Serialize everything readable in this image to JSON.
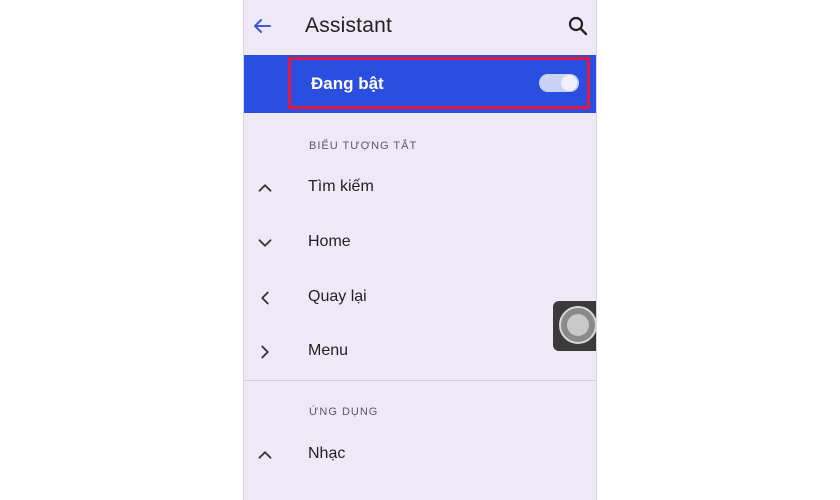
{
  "appbar": {
    "title": "Assistant",
    "back_icon": "arrow-left-icon",
    "search_icon": "search-icon"
  },
  "master_switch": {
    "label": "Đang bật",
    "state": "on",
    "highlight_color": "#e3193b",
    "bar_color": "#2a4fe0"
  },
  "sections": [
    {
      "header": "BIỂU TƯỢNG TẮT",
      "items": [
        {
          "icon": "chevron-up-icon",
          "label": "Tìm kiếm"
        },
        {
          "icon": "chevron-down-icon",
          "label": "Home"
        },
        {
          "icon": "chevron-left-icon",
          "label": "Quay lại"
        },
        {
          "icon": "chevron-right-icon",
          "label": "Menu"
        }
      ]
    },
    {
      "header": "ỨNG DỤNG",
      "items": [
        {
          "icon": "chevron-up-icon",
          "label": "Nhạc"
        }
      ]
    }
  ],
  "floating_button": {
    "icon": "assistive-touch-icon"
  }
}
